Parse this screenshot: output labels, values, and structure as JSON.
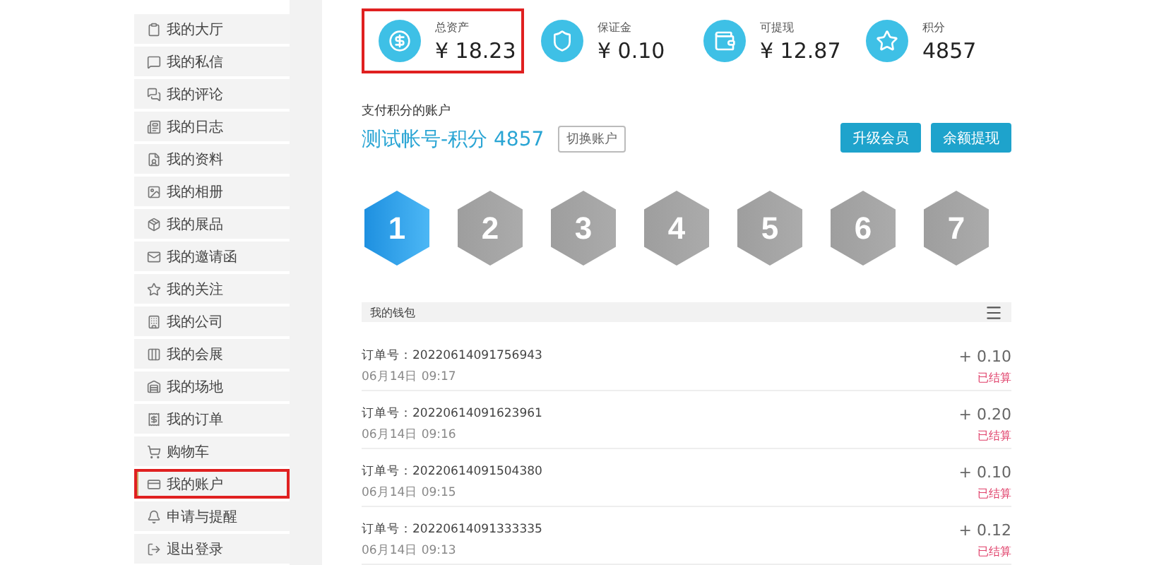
{
  "sidebar": {
    "items": [
      {
        "label": "我的大厅",
        "selected": false,
        "highlighted": false
      },
      {
        "label": "我的私信",
        "selected": false,
        "highlighted": false
      },
      {
        "label": "我的评论",
        "selected": false,
        "highlighted": false
      },
      {
        "label": "我的日志",
        "selected": false,
        "highlighted": false
      },
      {
        "label": "我的资料",
        "selected": false,
        "highlighted": false
      },
      {
        "label": "我的相册",
        "selected": false,
        "highlighted": false
      },
      {
        "label": "我的展品",
        "selected": false,
        "highlighted": false
      },
      {
        "label": "我的邀请函",
        "selected": false,
        "highlighted": false
      },
      {
        "label": "我的关注",
        "selected": false,
        "highlighted": false
      },
      {
        "label": "我的公司",
        "selected": false,
        "highlighted": false
      },
      {
        "label": "我的会展",
        "selected": false,
        "highlighted": false
      },
      {
        "label": "我的场地",
        "selected": false,
        "highlighted": false
      },
      {
        "label": "我的订单",
        "selected": false,
        "highlighted": false
      },
      {
        "label": "购物车",
        "selected": false,
        "highlighted": false
      },
      {
        "label": "我的账户",
        "selected": true,
        "highlighted": true
      },
      {
        "label": "申请与提醒",
        "selected": false,
        "highlighted": false
      },
      {
        "label": "退出登录",
        "selected": false,
        "highlighted": false
      }
    ]
  },
  "stats": [
    {
      "label": "总资产",
      "value": "¥ 18.23",
      "highlighted": true
    },
    {
      "label": "保证金",
      "value": "¥ 0.10",
      "highlighted": false
    },
    {
      "label": "可提现",
      "value": "¥ 12.87",
      "highlighted": false
    },
    {
      "label": "积分",
      "value": "4857",
      "highlighted": false
    }
  ],
  "account": {
    "caption": "支付积分的账户",
    "name": "测试帐号-积分 4857",
    "switch_button": "切换账户",
    "buttons": [
      "升级会员",
      "余额提现"
    ]
  },
  "levels": [
    {
      "label": "1",
      "selected": true
    },
    {
      "label": "2",
      "selected": false
    },
    {
      "label": "3",
      "selected": false
    },
    {
      "label": "4",
      "selected": false
    },
    {
      "label": "5",
      "selected": false
    },
    {
      "label": "6",
      "selected": false
    },
    {
      "label": "7",
      "selected": false
    }
  ],
  "wallet": {
    "title": "我的钱包",
    "rows": [
      {
        "order": "订单号：20220614091756943",
        "time": "06月14日 09:17",
        "amount": "+ 0.10",
        "status": "已结算"
      },
      {
        "order": "订单号：20220614091623961",
        "time": "06月14日 09:16",
        "amount": "+ 0.20",
        "status": "已结算"
      },
      {
        "order": "订单号：20220614091504380",
        "time": "06月14日 09:15",
        "amount": "+ 0.10",
        "status": "已结算"
      },
      {
        "order": "订单号：20220614091333335",
        "time": "06月14日 09:13",
        "amount": "+ 0.12",
        "status": "已结算"
      }
    ]
  }
}
